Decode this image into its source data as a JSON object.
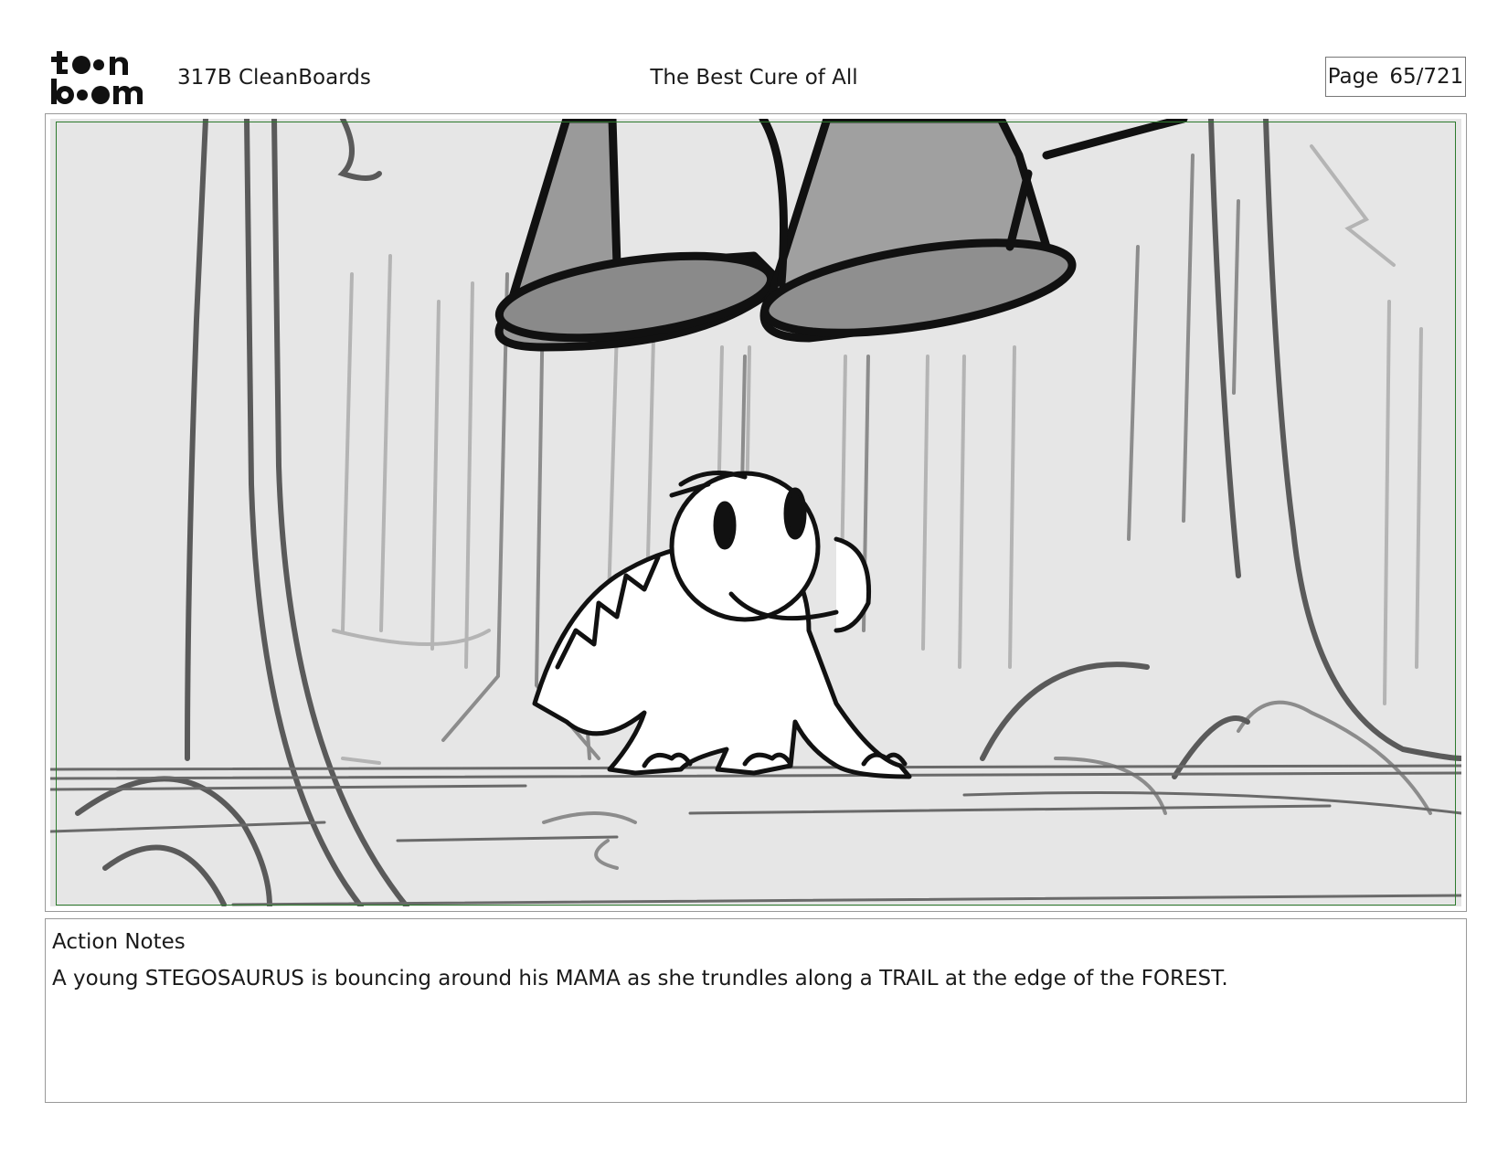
{
  "header": {
    "logo_text": "toonboom",
    "episode": "317B  CleanBoards",
    "title": "The Best Cure of All",
    "page_label": "Page",
    "page_number": "65/721"
  },
  "panel": {
    "safe_area_color": "#2d7a2d"
  },
  "notes": {
    "label": "Action Notes",
    "text": "A young STEGOSAURUS is bouncing around his MAMA as she trundles along a TRAIL at the edge of the FOREST."
  }
}
